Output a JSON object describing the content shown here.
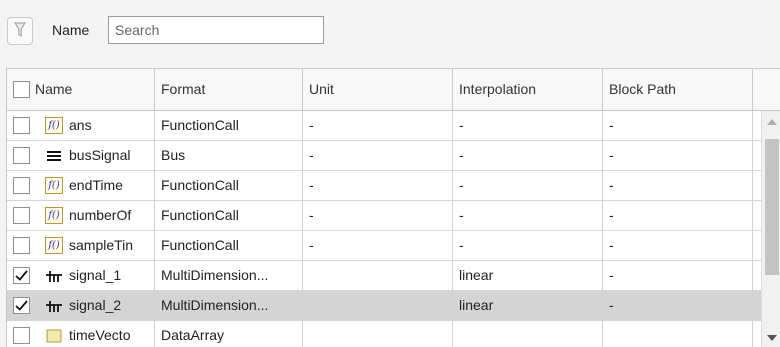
{
  "toolbar": {
    "name_label": "Name",
    "search_placeholder": "Search"
  },
  "columns": [
    "Name",
    "Format",
    "Unit",
    "Interpolation",
    "Block Path"
  ],
  "rows": [
    {
      "checked": false,
      "icon": "function-call-icon",
      "name": "ans",
      "format": "FunctionCall",
      "unit": "-",
      "interpolation": "-",
      "block_path": "-"
    },
    {
      "checked": false,
      "icon": "bus-icon",
      "name": "busSignal",
      "format": "Bus",
      "unit": "-",
      "interpolation": "-",
      "block_path": "-"
    },
    {
      "checked": false,
      "icon": "function-call-icon",
      "name": "endTime",
      "format": "FunctionCall",
      "unit": "-",
      "interpolation": "-",
      "block_path": "-"
    },
    {
      "checked": false,
      "icon": "function-call-icon",
      "name": "numberOf",
      "format": "FunctionCall",
      "unit": "-",
      "interpolation": "-",
      "block_path": "-"
    },
    {
      "checked": false,
      "icon": "function-call-icon",
      "name": "sampleTin",
      "format": "FunctionCall",
      "unit": "-",
      "interpolation": "-",
      "block_path": "-"
    },
    {
      "checked": true,
      "icon": "signal-icon",
      "name": "signal_1",
      "format": "MultiDimension...",
      "unit": "",
      "interpolation": "linear",
      "block_path": "-"
    },
    {
      "checked": true,
      "icon": "signal-icon",
      "name": "signal_2",
      "format": "MultiDimension...",
      "unit": "",
      "interpolation": "linear",
      "block_path": "-",
      "selected": true
    },
    {
      "checked": false,
      "icon": "data-array-icon",
      "name": "timeVecto",
      "format": "DataArray",
      "unit": "",
      "interpolation": "",
      "block_path": ""
    }
  ],
  "colors": {
    "selected_row": "#d4d4d4",
    "function_icon_border": "#b99a2e"
  }
}
